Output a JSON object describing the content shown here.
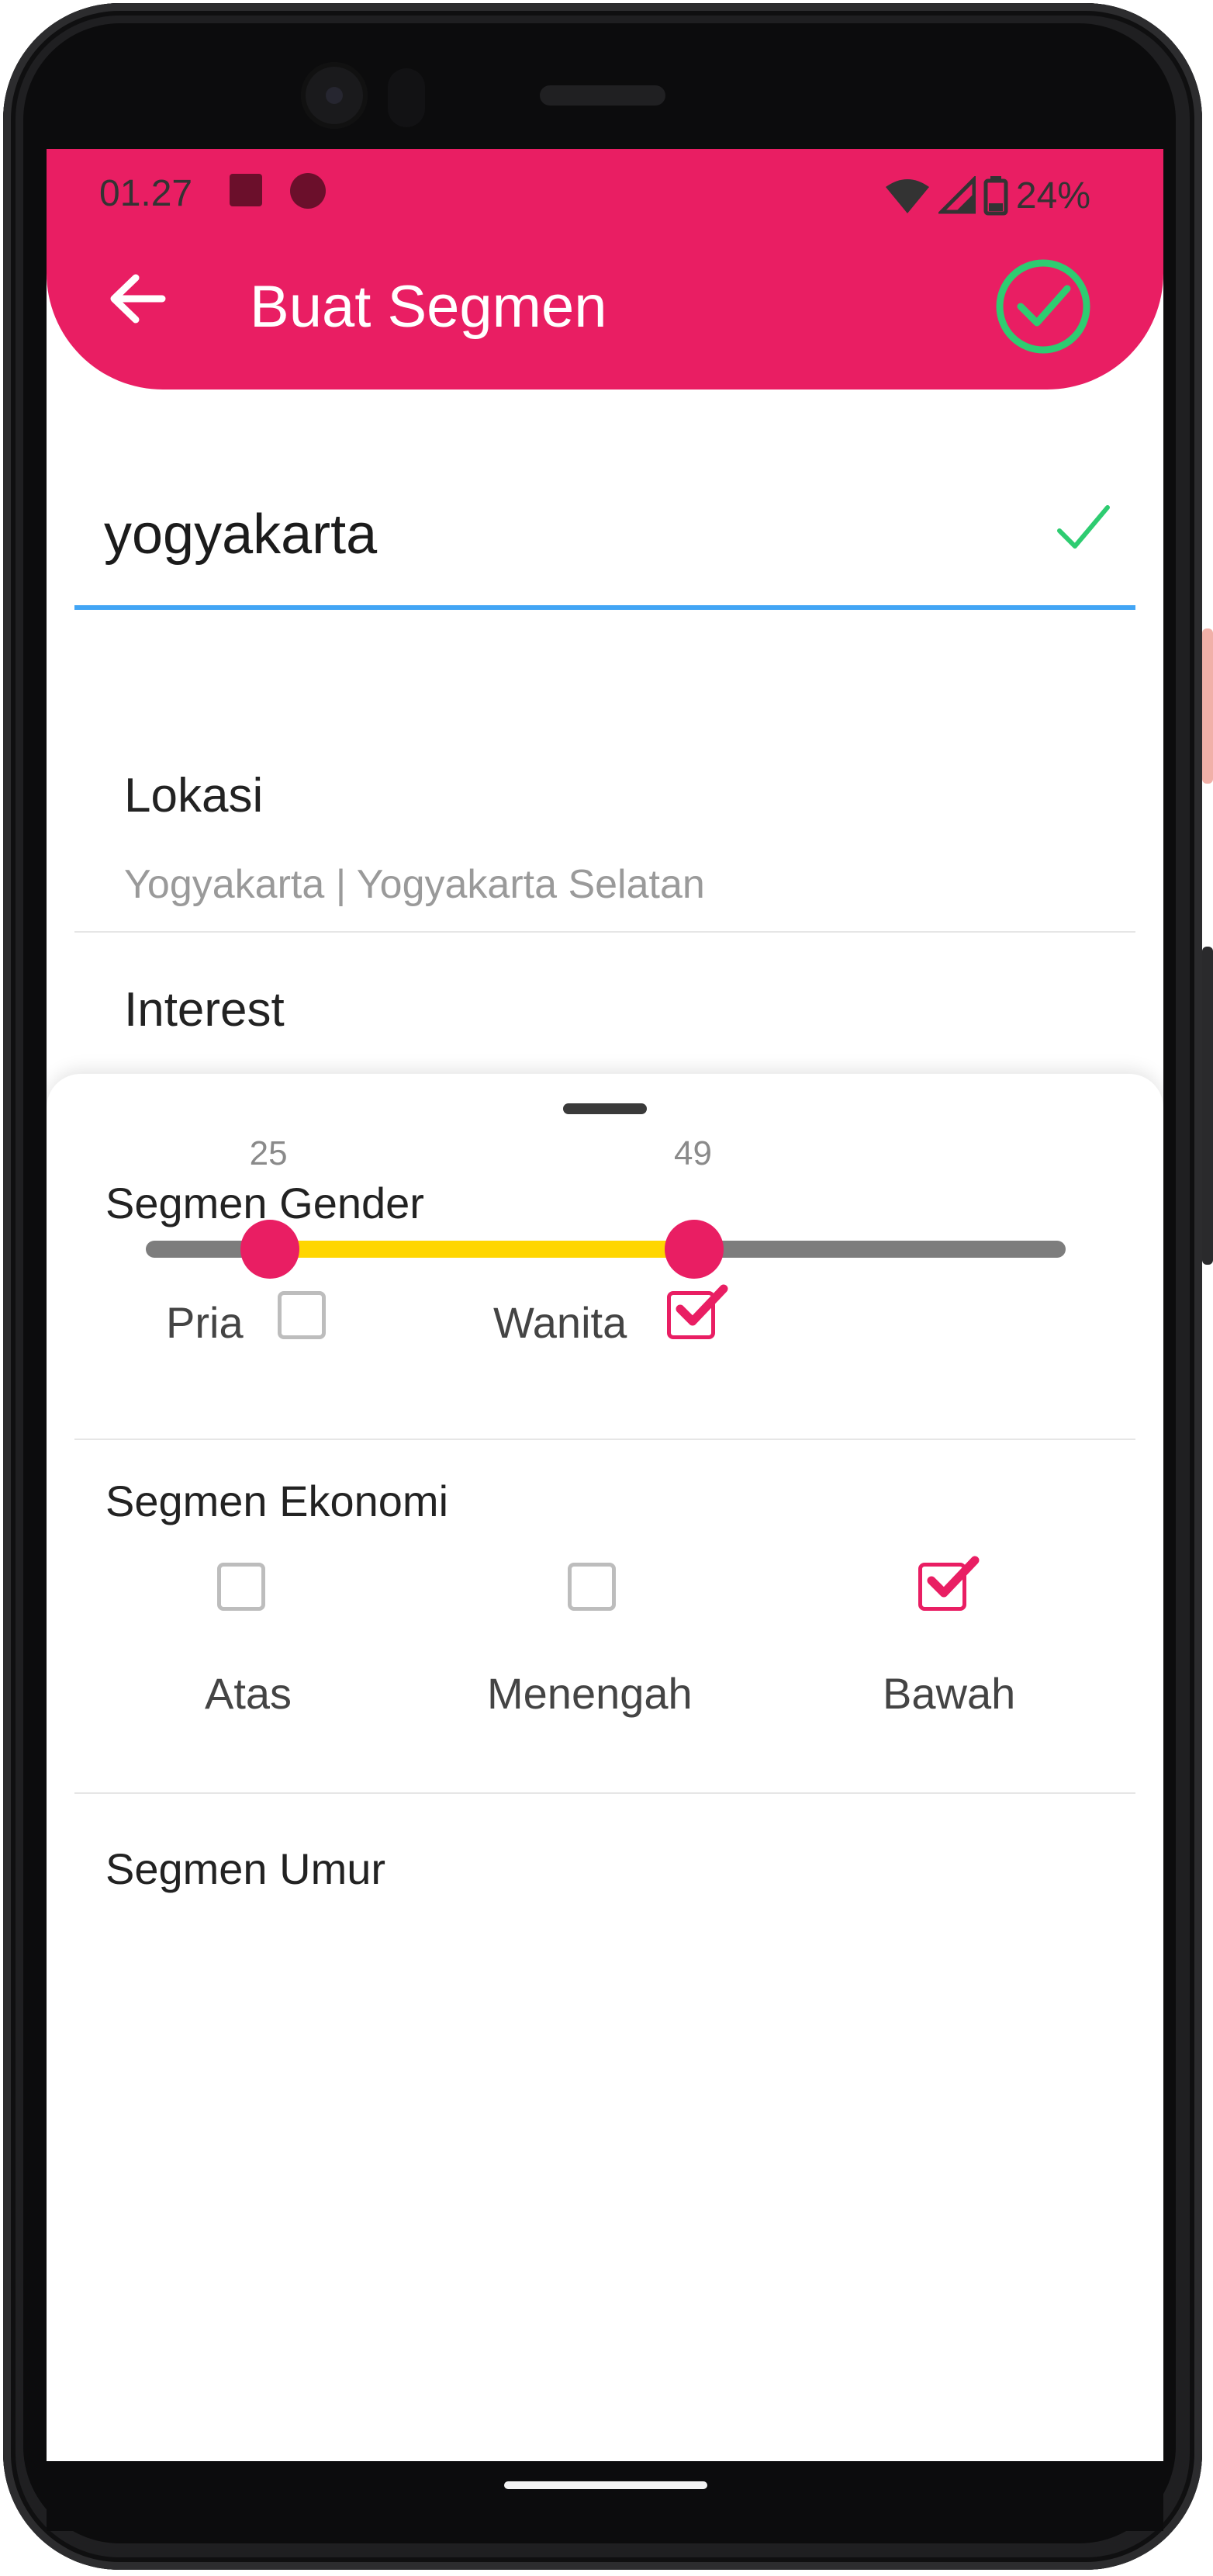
{
  "status_bar": {
    "time": "01.27",
    "battery": "24%"
  },
  "app_bar": {
    "title": "Buat Segmen",
    "colors": {
      "primary": "#e91e63",
      "confirm": "#2ecc71"
    }
  },
  "name_field": {
    "value": "yogyakarta"
  },
  "location": {
    "title": "Lokasi",
    "value": "Yogyakarta | Yogyakarta Selatan"
  },
  "interest": {
    "title": "Interest"
  },
  "gender_section": {
    "title": "Segmen Gender",
    "options": [
      {
        "label": "Pria",
        "checked": false
      },
      {
        "label": "Wanita",
        "checked": true
      }
    ]
  },
  "economy_section": {
    "title": "Segmen Ekonomi",
    "options": [
      {
        "label": "Atas",
        "checked": false
      },
      {
        "label": "Menengah",
        "checked": false
      },
      {
        "label": "Bawah",
        "checked": true
      }
    ]
  },
  "age_section": {
    "title": "Segmen Umur",
    "min": 18,
    "max": 70,
    "low": 25,
    "high": 49,
    "low_label": "25",
    "high_label": "49",
    "colors": {
      "track": "#7d7d7d",
      "range": "#ffd600",
      "thumb": "#e91e63"
    }
  }
}
